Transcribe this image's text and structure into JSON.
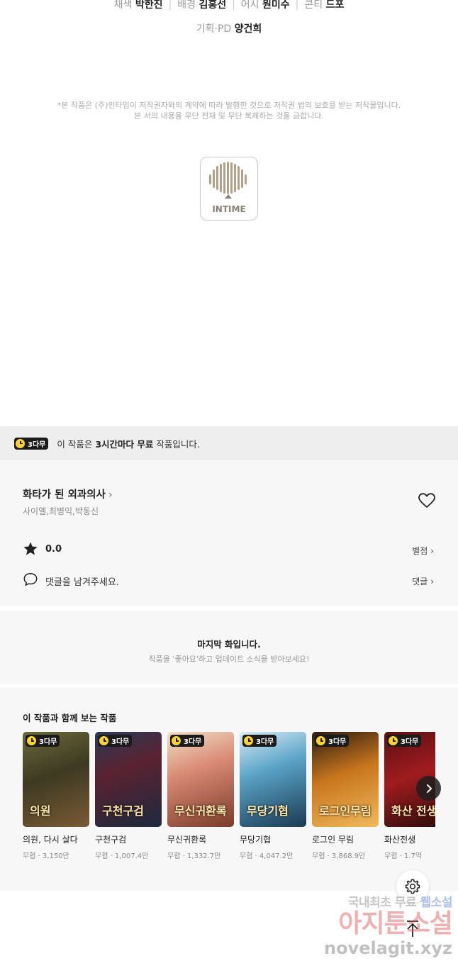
{
  "credits": {
    "line1": [
      {
        "role": "채색",
        "name": "박한진"
      },
      {
        "role": "배경",
        "name": "김홍선"
      },
      {
        "role": "어시",
        "name": "원미수"
      },
      {
        "role": "콘티",
        "name": "드포"
      }
    ],
    "line2": {
      "role": "기획·PD",
      "name": "양건희"
    }
  },
  "notice": {
    "line1": "*본 작품은 (주)인타임이 저작권자와의 계약에 따라 발행한 것으로 저작권 법의 보호를 받는 저작물입니다.",
    "line2": "본 서의 내용을 무단 전재 및 무단 복제하는 것을 금합니다."
  },
  "publisher_logo": {
    "text": "INTIME",
    "icon": "intime-logo"
  },
  "free_bar": {
    "badge": "3다무",
    "text_before": "이 작품은 ",
    "text_bold": "3시간마다 무료",
    "text_after": " 작품입니다."
  },
  "series": {
    "title": "화타가 된 외과의사",
    "authors": "사이엘,최병익,박동신",
    "rating": "0.0",
    "rating_link": "별점",
    "comment_prompt": "댓글을 남겨주세요.",
    "comment_link": "댓글"
  },
  "last_episode": {
    "heading": "마지막 화입니다.",
    "sub": "작품을 '좋아요'하고 업데이트 소식을 받아보세요!"
  },
  "recommendations": {
    "heading": "이 작품과 함께 보는 작품",
    "items": [
      {
        "title": "의원, 다시 살다",
        "meta": "무협 · 3,150만",
        "badge": "3다무",
        "art": "의원"
      },
      {
        "title": "구천구검",
        "meta": "무협 · 1,007.4만",
        "badge": "3다무",
        "art": "구천구검"
      },
      {
        "title": "무신귀환록",
        "meta": "무협 · 1,332.7만",
        "badge": "3다무",
        "art": "무신귀환록"
      },
      {
        "title": "무당기협",
        "meta": "무협 · 4,047.2만",
        "badge": "3다무",
        "art": "무당기협"
      },
      {
        "title": "로그인 무림",
        "meta": "무협 · 3,868.9만",
        "badge": "3다무",
        "art": "로그인무림"
      },
      {
        "title": "화산전생",
        "meta": "무협 · 1.7억",
        "badge": "3다무",
        "art": "화산 전생"
      }
    ]
  },
  "watermark": {
    "line1_a": "국내최초 무료 ",
    "line1_b": "웹소설",
    "line2": "아지툰소설",
    "line3": "novelagit.xyz"
  },
  "colors": {
    "badge_yellow": "#ffd233",
    "badge_dark": "#1b1b1b",
    "panel_bg": "#f7f7f7",
    "free_bar_bg": "#eeeeee"
  }
}
